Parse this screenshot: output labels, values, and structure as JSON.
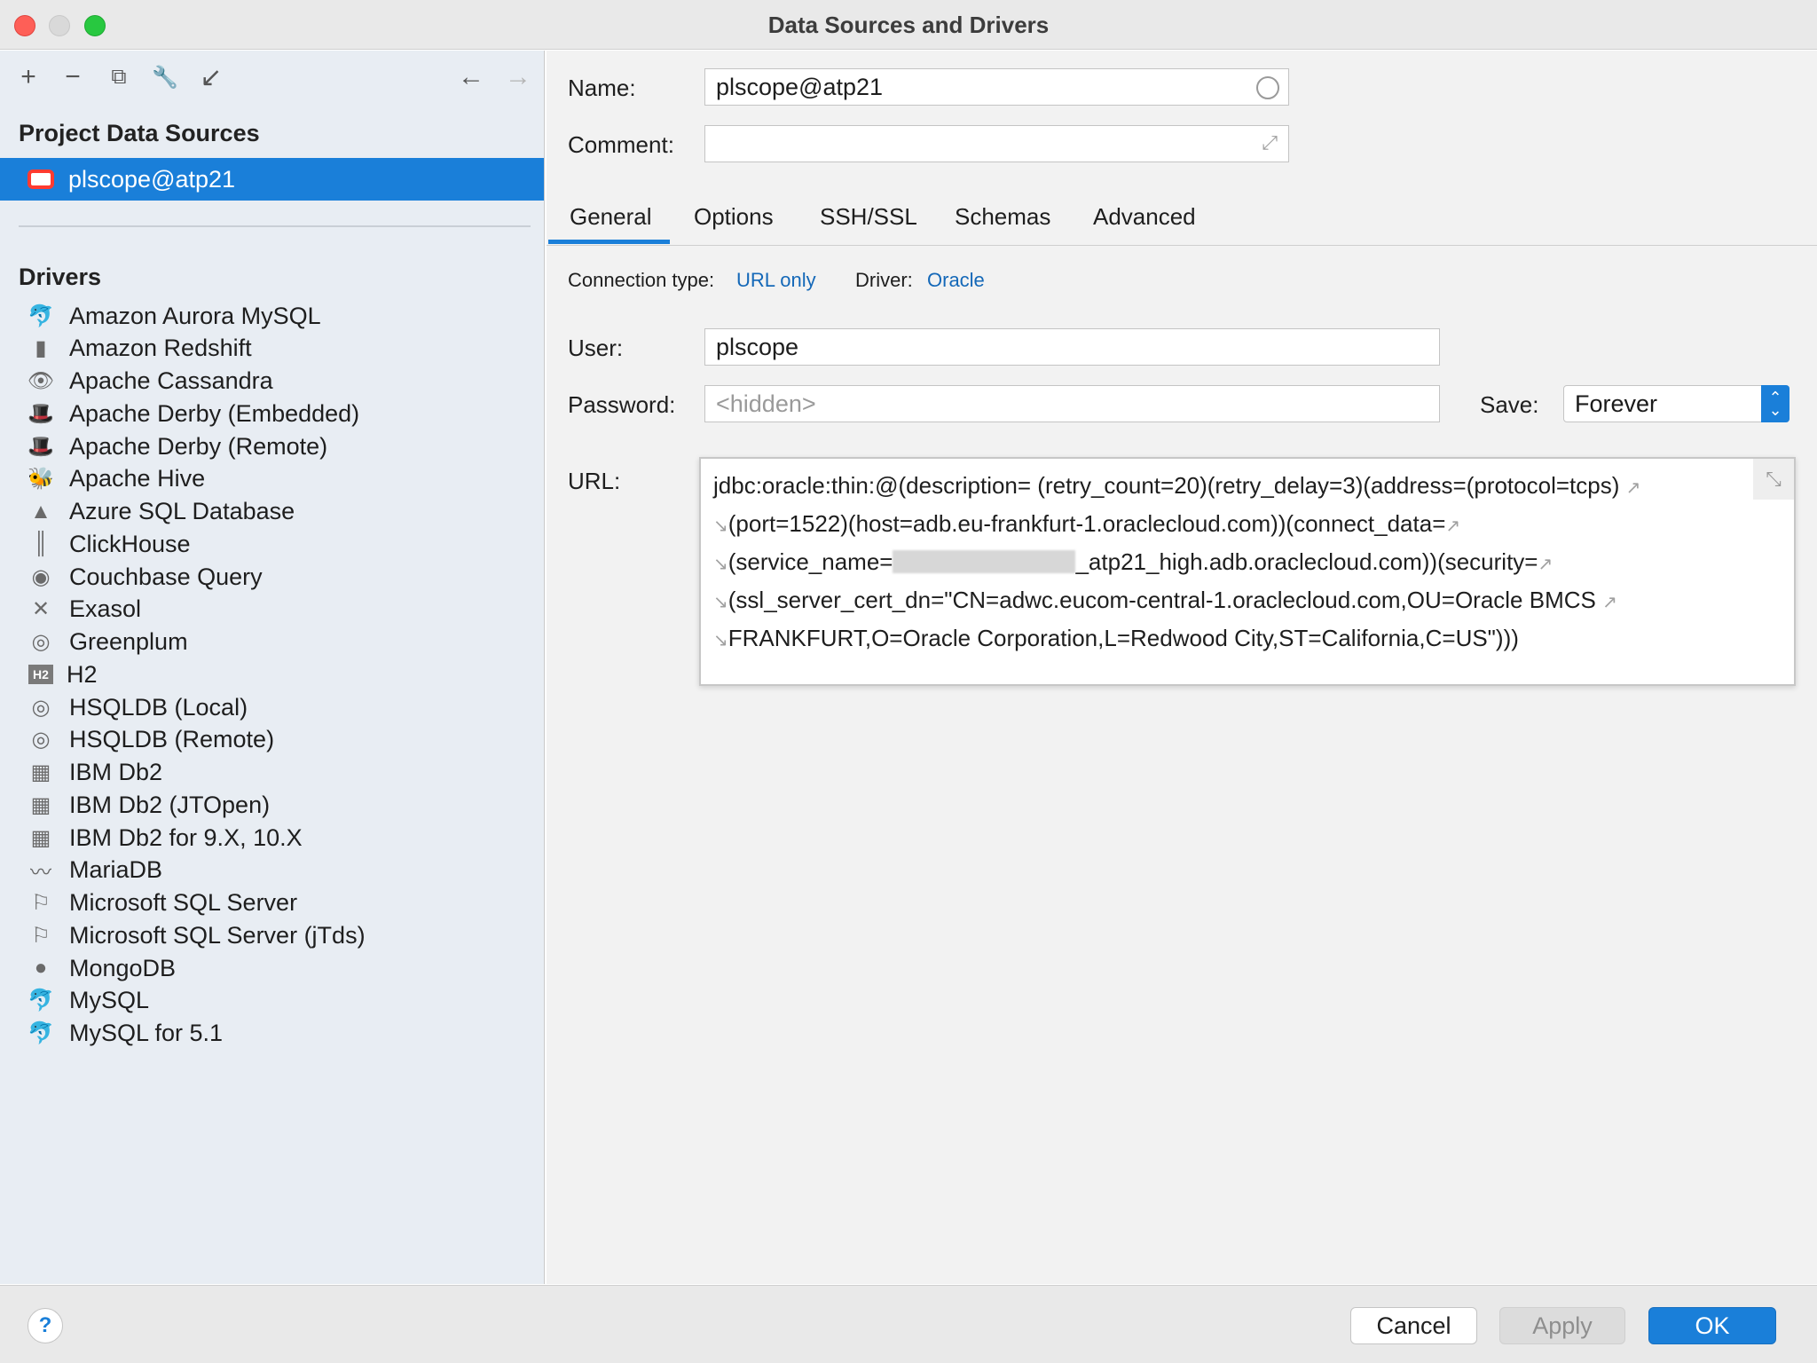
{
  "window": {
    "title": "Data Sources and Drivers"
  },
  "toolbar": {
    "add": "+",
    "remove": "−",
    "copy": "⧉",
    "settings": "🔧",
    "import": "↙",
    "back": "←",
    "forward": "→"
  },
  "left": {
    "project_header": "Project Data Sources",
    "data_sources": [
      {
        "label": "plscope@atp21"
      }
    ],
    "drivers_header": "Drivers",
    "drivers": [
      {
        "label": "Amazon Aurora MySQL",
        "glyph": "🐬"
      },
      {
        "label": "Amazon Redshift",
        "glyph": "▮"
      },
      {
        "label": "Apache Cassandra",
        "glyph": "👁"
      },
      {
        "label": "Apache Derby (Embedded)",
        "glyph": "🎩"
      },
      {
        "label": "Apache Derby (Remote)",
        "glyph": "🎩"
      },
      {
        "label": "Apache Hive",
        "glyph": "🐝"
      },
      {
        "label": "Azure SQL Database",
        "glyph": "▲"
      },
      {
        "label": "ClickHouse",
        "glyph": "║"
      },
      {
        "label": "Couchbase Query",
        "glyph": "◉"
      },
      {
        "label": "Exasol",
        "glyph": "✕"
      },
      {
        "label": "Greenplum",
        "glyph": "◎"
      },
      {
        "label": "H2",
        "glyph": "H2"
      },
      {
        "label": "HSQLDB (Local)",
        "glyph": "◎"
      },
      {
        "label": "HSQLDB (Remote)",
        "glyph": "◎"
      },
      {
        "label": "IBM Db2",
        "glyph": "▦"
      },
      {
        "label": "IBM Db2 (JTOpen)",
        "glyph": "▦"
      },
      {
        "label": "IBM Db2 for 9.X, 10.X",
        "glyph": "▦"
      },
      {
        "label": "MariaDB",
        "glyph": "〰"
      },
      {
        "label": "Microsoft SQL Server",
        "glyph": "⚐"
      },
      {
        "label": "Microsoft SQL Server (jTds)",
        "glyph": "⚐"
      },
      {
        "label": "MongoDB",
        "glyph": "●"
      },
      {
        "label": "MySQL",
        "glyph": "🐬"
      },
      {
        "label": "MySQL for 5.1",
        "glyph": "🐬"
      }
    ]
  },
  "form": {
    "name_label": "Name:",
    "name_value": "plscope@atp21",
    "comment_label": "Comment:",
    "comment_value": "",
    "tabs": [
      "General",
      "Options",
      "SSH/SSL",
      "Schemas",
      "Advanced"
    ],
    "connection_type_label": "Connection type:",
    "connection_type_value": "URL only",
    "driver_label": "Driver:",
    "driver_value": "Oracle",
    "user_label": "User:",
    "user_value": "plscope",
    "password_label": "Password:",
    "password_placeholder": "<hidden>",
    "save_label": "Save:",
    "save_value": "Forever",
    "url_label": "URL:",
    "url_lines": [
      "jdbc:oracle:thin:@(description= (retry_count=20)(retry_delay=3)(address=(protocol=tcps)",
      "(port=1522)(host=adb.eu-frankfurt-1.oraclecloud.com))(connect_data=",
      "(service_name=",
      "_atp21_high.adb.oraclecloud.com))(security=",
      "(ssl_server_cert_dn=\"CN=adwc.eucom-central-1.oraclecloud.com,OU=Oracle BMCS",
      "FRANKFURT,O=Oracle Corporation,L=Redwood City,ST=California,C=US\")))"
    ]
  },
  "footer": {
    "help": "?",
    "cancel": "Cancel",
    "apply": "Apply",
    "ok": "OK"
  },
  "colors": {
    "accent": "#1a7fd9",
    "selection": "#1a7fd9",
    "link": "#1468b8"
  }
}
